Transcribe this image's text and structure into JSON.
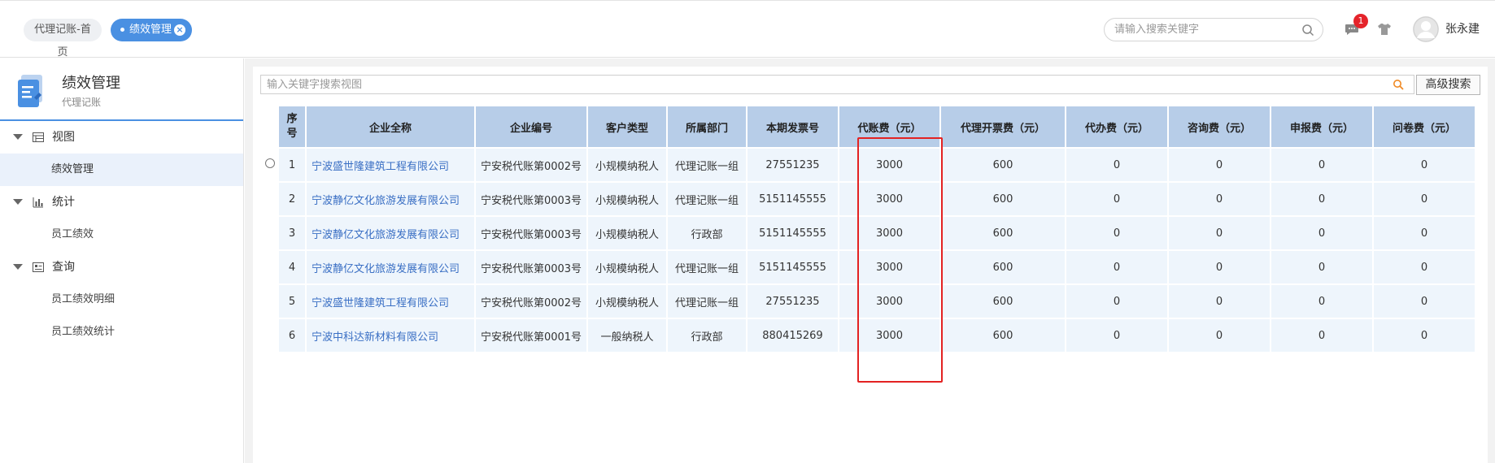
{
  "topbar": {
    "tabs": [
      {
        "label": "代理记账-首页"
      },
      {
        "label": "绩效管理"
      }
    ],
    "search_placeholder": "请输入搜索关键字",
    "message_count": "1",
    "username": "张永建"
  },
  "sidebar": {
    "title": "绩效管理",
    "subtitle": "代理记账",
    "groups": [
      {
        "label": "视图",
        "icon": "table-icon",
        "items": [
          "绩效管理"
        ]
      },
      {
        "label": "统计",
        "icon": "bar-chart-icon",
        "items": [
          "员工绩效"
        ]
      },
      {
        "label": "查询",
        "icon": "query-icon",
        "items": [
          "员工绩效明细",
          "员工绩效统计"
        ]
      }
    ],
    "active_item": "绩效管理"
  },
  "main": {
    "search_placeholder": "输入关键字搜索视图",
    "advanced_search_label": "高级搜索",
    "table": {
      "headers": [
        "序号",
        "企业全称",
        "企业编号",
        "客户类型",
        "所属部门",
        "本期发票号",
        "代账费（元）",
        "代理开票费（元）",
        "代办费（元）",
        "咨询费（元）",
        "申报费（元）",
        "问卷费（元）"
      ],
      "rows": [
        [
          "1",
          "宁波盛世隆建筑工程有限公司",
          "宁安税代账第0002号",
          "小规模纳税人",
          "代理记账一组",
          "27551235",
          "3000",
          "600",
          "0",
          "0",
          "0",
          "0"
        ],
        [
          "2",
          "宁波静亿文化旅游发展有限公司",
          "宁安税代账第0003号",
          "小规模纳税人",
          "代理记账一组",
          "5151145555",
          "3000",
          "600",
          "0",
          "0",
          "0",
          "0"
        ],
        [
          "3",
          "宁波静亿文化旅游发展有限公司",
          "宁安税代账第0003号",
          "小规模纳税人",
          "行政部",
          "5151145555",
          "3000",
          "600",
          "0",
          "0",
          "0",
          "0"
        ],
        [
          "4",
          "宁波静亿文化旅游发展有限公司",
          "宁安税代账第0003号",
          "小规模纳税人",
          "代理记账一组",
          "5151145555",
          "3000",
          "600",
          "0",
          "0",
          "0",
          "0"
        ],
        [
          "5",
          "宁波盛世隆建筑工程有限公司",
          "宁安税代账第0002号",
          "小规模纳税人",
          "代理记账一组",
          "27551235",
          "3000",
          "600",
          "0",
          "0",
          "0",
          "0"
        ],
        [
          "6",
          "宁波中科达新材料有限公司",
          "宁安税代账第0001号",
          "一般纳税人",
          "行政部",
          "880415269",
          "3000",
          "600",
          "0",
          "0",
          "0",
          "0"
        ]
      ]
    }
  },
  "colors": {
    "accent": "#4a90e2",
    "header_bg": "#b7cde8",
    "row_bg": "#eef5fc",
    "link": "#3a6fc4",
    "highlight": "#e32222",
    "badge": "#e5242b"
  }
}
